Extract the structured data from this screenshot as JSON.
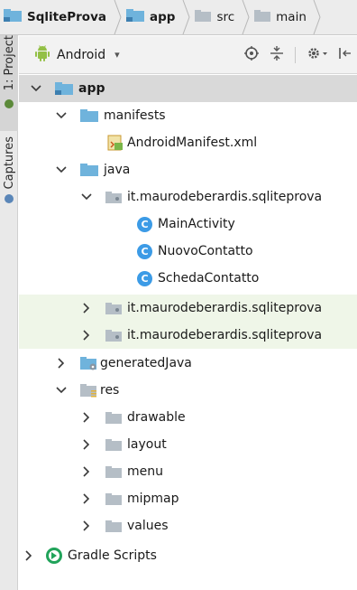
{
  "breadcrumb": [
    {
      "label": "SqliteProva",
      "bold": true
    },
    {
      "label": "app",
      "bold": true
    },
    {
      "label": "src",
      "bold": false
    },
    {
      "label": "main",
      "bold": false
    }
  ],
  "side_tabs": {
    "project": "1: Project",
    "captures": "Captures"
  },
  "toolbar": {
    "view_mode": "Android",
    "caret": "▾"
  },
  "tree": [
    {
      "label": "app",
      "type": "module",
      "bold": true
    },
    {
      "label": "manifests",
      "type": "folder"
    },
    {
      "label": "AndroidManifest.xml",
      "type": "manifest"
    },
    {
      "label": "java",
      "type": "folder"
    },
    {
      "label": "it.maurodeberardis.sqliteprova",
      "type": "package"
    },
    {
      "label": "MainActivity",
      "type": "class"
    },
    {
      "label": "NuovoContatto",
      "type": "class"
    },
    {
      "label": "SchedaContatto",
      "type": "class"
    },
    {
      "label": "it.maurodeberardis.sqliteprova",
      "type": "package"
    },
    {
      "label": "it.maurodeberardis.sqliteprova",
      "type": "package"
    },
    {
      "label": "generatedJava",
      "type": "gen-folder"
    },
    {
      "label": "res",
      "type": "res-folder"
    },
    {
      "label": "drawable",
      "type": "res-sub"
    },
    {
      "label": "layout",
      "type": "res-sub"
    },
    {
      "label": "menu",
      "type": "res-sub"
    },
    {
      "label": "mipmap",
      "type": "res-sub"
    },
    {
      "label": "values",
      "type": "res-sub"
    },
    {
      "label": "Gradle Scripts",
      "type": "gradle"
    }
  ],
  "class_letter": "C"
}
